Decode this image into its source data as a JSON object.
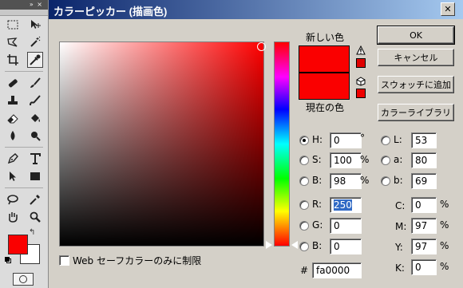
{
  "dialog": {
    "title": "カラーピッカー (描画色)",
    "close_icon": "close-icon"
  },
  "labels": {
    "new": "新しい色",
    "current": "現在の色",
    "web_only": "Web セーフカラーのみに制限"
  },
  "buttons": {
    "ok": "OK",
    "cancel": "キャンセル",
    "add_swatch": "スウォッチに追加",
    "color_libraries": "カラーライブラリ"
  },
  "colors": {
    "new": "#fa0000",
    "current": "#fa0000",
    "gamut_swatch": "#e00000",
    "websafe_swatch": "#ee0000",
    "foreground": "#fa0000",
    "background": "#ffffff"
  },
  "hsb": {
    "h": {
      "label": "H",
      "value": "0",
      "unit": "°",
      "selected": true
    },
    "s": {
      "label": "S",
      "value": "100",
      "unit": "%"
    },
    "b": {
      "label": "B",
      "value": "98",
      "unit": "%"
    }
  },
  "rgb": {
    "r": {
      "label": "R",
      "value": "250"
    },
    "g": {
      "label": "G",
      "value": "0"
    },
    "b": {
      "label": "B",
      "value": "0"
    }
  },
  "lab": {
    "l": {
      "label": "L",
      "value": "53"
    },
    "a": {
      "label": "a",
      "value": "80"
    },
    "b": {
      "label": "b",
      "value": "69"
    }
  },
  "cmyk": {
    "c": {
      "label": "C",
      "value": "0",
      "unit": "%"
    },
    "m": {
      "label": "M",
      "value": "97",
      "unit": "%"
    },
    "y": {
      "label": "Y",
      "value": "97",
      "unit": "%"
    },
    "k": {
      "label": "K",
      "value": "0",
      "unit": "%"
    }
  },
  "hex": {
    "label": "#",
    "value": "fa0000"
  },
  "tools": [
    "marquee",
    "move",
    "lasso",
    "magic-wand",
    "crop",
    "eyedropper",
    "healing-brush",
    "brush",
    "clone-stamp",
    "history-brush",
    "eraser",
    "paint-bucket",
    "blur",
    "dodge",
    "pen",
    "type",
    "path-selection",
    "rectangle",
    "notes",
    "eyedropper-2",
    "hand",
    "zoom"
  ],
  "active_tool": "eyedropper"
}
